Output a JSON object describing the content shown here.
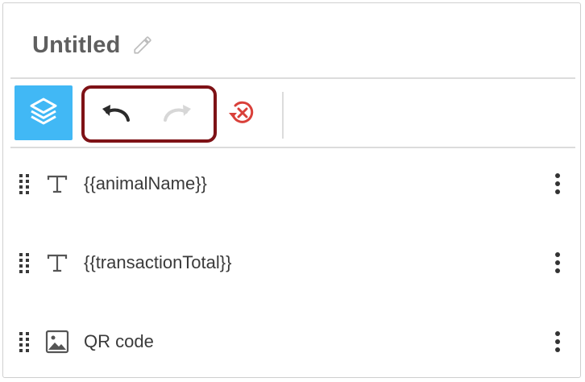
{
  "header": {
    "title": "Untitled",
    "edit_icon": "pencil-icon"
  },
  "toolbar": {
    "layers_icon": "layers-icon",
    "undo_icon": "undo-icon",
    "redo_icon": "redo-icon",
    "reset_icon": "reset-history-icon",
    "accent_color": "#41b8f5",
    "highlight_color": "#7e1216",
    "reset_color": "#d9403a"
  },
  "elements": [
    {
      "label": "{{animalName}}",
      "type_icon": "text-icon"
    },
    {
      "label": "{{transactionTotal}}",
      "type_icon": "text-icon"
    },
    {
      "label": "QR code",
      "type_icon": "image-icon"
    }
  ]
}
